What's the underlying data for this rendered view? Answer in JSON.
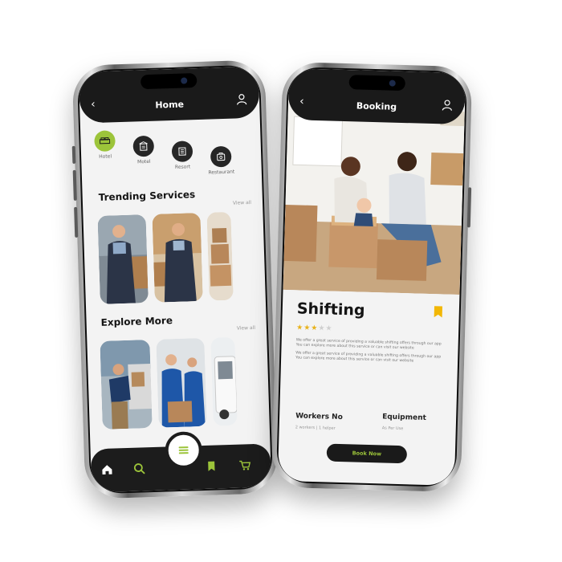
{
  "home": {
    "title": "Home",
    "categories": [
      {
        "label": "Hotel"
      },
      {
        "label": "Motel"
      },
      {
        "label": "Resort"
      },
      {
        "label": "Restaurant"
      }
    ],
    "trending": {
      "title": "Trending Services",
      "view_all": "View all"
    },
    "explore": {
      "title": "Explore More",
      "view_all": "View all"
    },
    "nav": [
      "home-icon",
      "search-icon",
      "menu-icon",
      "bookmark-icon",
      "cart-icon"
    ]
  },
  "booking": {
    "title": "Booking",
    "service_title": "Shifting",
    "rating": 3,
    "rating_max": 5,
    "description": [
      "We offer a great service of providing a valuable shifting offers through our app",
      "You can explore more about this service or can visit our website",
      "We offer a great service of providing a valuable shifting offers through our app",
      "You can explore more about this service or can visit our website"
    ],
    "workers": {
      "label": "Workers No",
      "value": "2 workers  |  1 helper"
    },
    "equipment": {
      "label": "Equipment",
      "value": "As Per Use"
    },
    "book_label": "Book Now"
  },
  "colors": {
    "accent": "#9cc43a",
    "dark": "#1a1a1a",
    "star": "#e8b21a",
    "bookmark": "#f2b705"
  }
}
